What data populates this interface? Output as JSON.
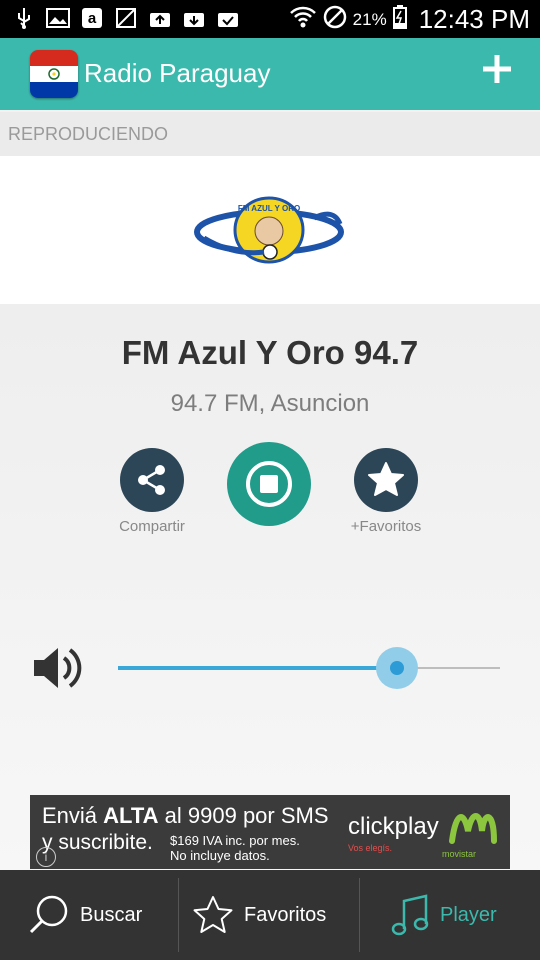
{
  "status_bar": {
    "icons": [
      "usb-icon",
      "image-icon",
      "amazon-icon",
      "signal-off-icon",
      "briefcase-upload-icon",
      "briefcase-download-icon",
      "briefcase-check-icon",
      "wifi-icon",
      "do-not-disturb-icon",
      "battery-charging-icon"
    ],
    "battery": "21%",
    "time": "12:43 PM"
  },
  "app_bar": {
    "title": "Radio Paraguay",
    "add_icon": "plus-icon",
    "color": "#3cb9ad"
  },
  "section": {
    "label": "REPRODUCIENDO"
  },
  "logo": {
    "text": "FM AZUL Y ORO"
  },
  "station": {
    "name": "FM Azul Y Oro 94.7",
    "subtitle": "94.7 FM, Asuncion"
  },
  "controls": {
    "share_label": "Compartir",
    "favorite_label": "+Favoritos",
    "play_state": "stop"
  },
  "volume": {
    "level": 0.73
  },
  "ad": {
    "line1_pre": "Enviá ",
    "line1_bold": "ALTA",
    "line1_post": " al 9909 por SMS",
    "line2": "y suscribite.",
    "price_line1": "$169 IVA inc. por mes.",
    "price_line2": "No incluye datos.",
    "brand": "clickplay",
    "brand_sub": "Vos elegís.",
    "brand2": "movistar"
  },
  "bottom_nav": {
    "items": [
      {
        "label": "Buscar",
        "icon": "search-icon"
      },
      {
        "label": "Favoritos",
        "icon": "star-icon"
      },
      {
        "label": "Player",
        "icon": "music-note-icon"
      }
    ],
    "active": "Player"
  }
}
